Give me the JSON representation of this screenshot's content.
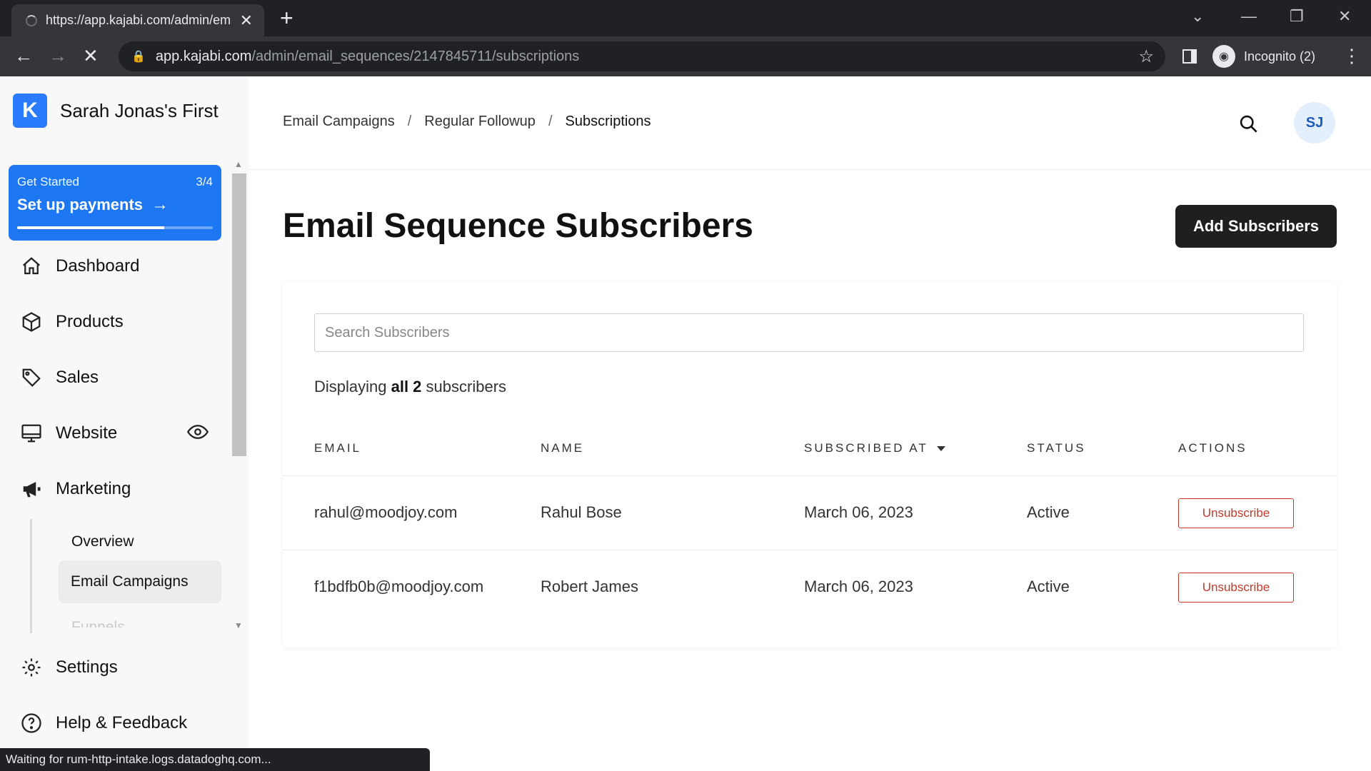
{
  "browser": {
    "tab_title": "https://app.kajabi.com/admin/em",
    "url_host": "app.kajabi.com",
    "url_path": "/admin/email_sequences/2147845711/subscriptions",
    "incognito_label": "Incognito (2)",
    "status_text": "Waiting for rum-http-intake.logs.datadoghq.com..."
  },
  "sidebar": {
    "brand": "Sarah Jonas's First",
    "get_started": {
      "label": "Get Started",
      "progress_text": "3/4",
      "progress_value": 0.75,
      "title": "Set up payments"
    },
    "nav": {
      "dashboard": "Dashboard",
      "products": "Products",
      "sales": "Sales",
      "website": "Website",
      "marketing": "Marketing",
      "settings": "Settings",
      "help": "Help & Feedback"
    },
    "marketing_sub": {
      "overview": "Overview",
      "email_campaigns": "Email Campaigns",
      "partial": "Funnels"
    }
  },
  "header": {
    "breadcrumb": [
      "Email Campaigns",
      "Regular Followup",
      "Subscriptions"
    ],
    "avatar_initials": "SJ"
  },
  "main": {
    "title": "Email Sequence Subscribers",
    "add_button": "Add Subscribers",
    "search_placeholder": "Search Subscribers",
    "count_prefix": "Displaying ",
    "count_bold": "all 2",
    "count_suffix": " subscribers",
    "columns": {
      "email": "EMAIL",
      "name": "NAME",
      "subscribed_at": "SUBSCRIBED AT",
      "status": "STATUS",
      "actions": "ACTIONS"
    },
    "rows": [
      {
        "email": "rahul@moodjoy.com",
        "name": "Rahul Bose",
        "subscribed_at": "March 06, 2023",
        "status": "Active",
        "action": "Unsubscribe"
      },
      {
        "email": "f1bdfb0b@moodjoy.com",
        "name": "Robert James",
        "subscribed_at": "March 06, 2023",
        "status": "Active",
        "action": "Unsubscribe"
      }
    ]
  },
  "colors": {
    "brand_blue": "#1d77f2",
    "danger": "#c0392b",
    "primary_button": "#1f1f1f"
  }
}
